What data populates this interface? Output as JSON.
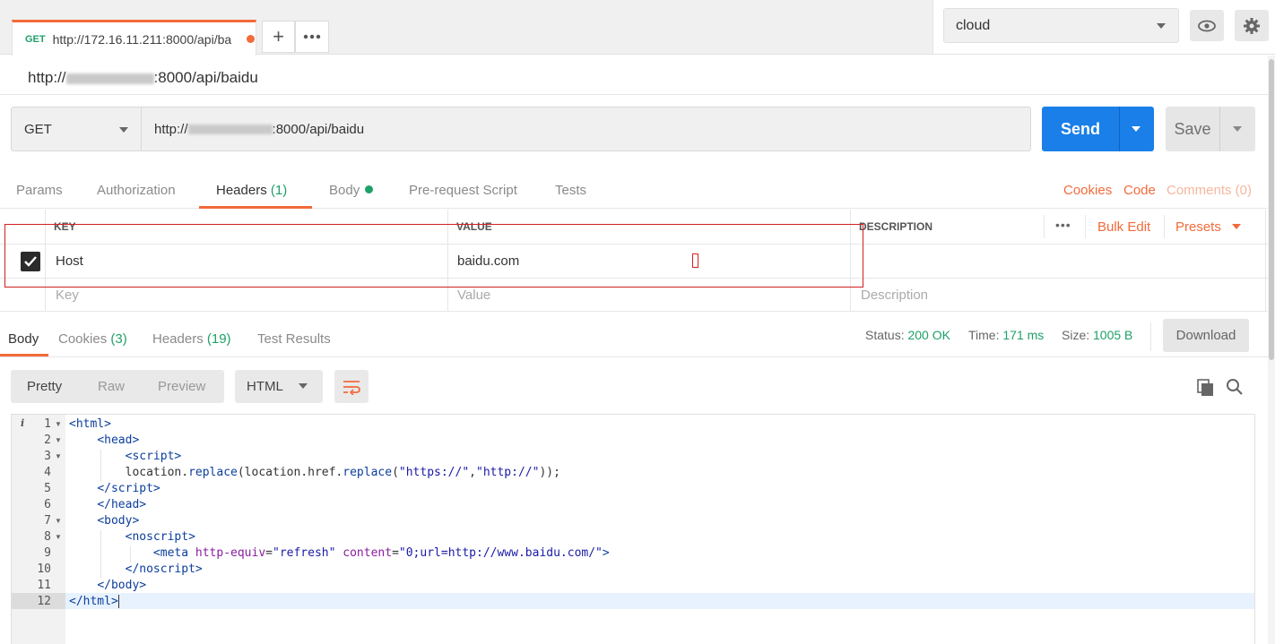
{
  "request_tab": {
    "method": "GET",
    "url": "http://172.16.11.211:8000/api/ba"
  },
  "environment": {
    "selected": "cloud"
  },
  "request_name": {
    "prefix": "http://",
    "suffix": ":8000/api/baidu"
  },
  "url_bar": {
    "method": "GET",
    "url_prefix": "http://",
    "url_suffix": ":8000/api/baidu"
  },
  "buttons": {
    "send": "Send",
    "save": "Save"
  },
  "request_tabs": {
    "params": "Params",
    "authorization": "Authorization",
    "headers": "Headers",
    "headers_count": "(1)",
    "body": "Body",
    "pre_request": "Pre-request Script",
    "tests": "Tests",
    "cookies": "Cookies",
    "code": "Code",
    "comments": "Comments (0)"
  },
  "headers_table": {
    "columns": {
      "key": "KEY",
      "value": "VALUE",
      "description": "DESCRIPTION"
    },
    "more": "•••",
    "bulk_edit": "Bulk Edit",
    "presets": "Presets",
    "rows": [
      {
        "key": "Host",
        "value": "baidu.com",
        "description": "",
        "enabled": true
      }
    ],
    "placeholders": {
      "key": "Key",
      "value": "Value",
      "description": "Description"
    }
  },
  "response_tabs": {
    "body": "Body",
    "cookies": "Cookies",
    "cookies_count": "(3)",
    "headers": "Headers",
    "headers_count": "(19)",
    "test_results": "Test Results"
  },
  "response_status": {
    "status_label": "Status:",
    "status": "200 OK",
    "time_label": "Time:",
    "time": "171 ms",
    "size_label": "Size:",
    "size": "1005 B"
  },
  "download": "Download",
  "format": {
    "pretty": "Pretty",
    "raw": "Raw",
    "preview": "Preview",
    "language": "HTML"
  },
  "code_lines": [
    "1",
    "2",
    "3",
    "4",
    "5",
    "6",
    "7",
    "8",
    "9",
    "10",
    "11",
    "12"
  ],
  "colors": {
    "accent": "#f26b3a",
    "send": "#1a7fe8",
    "success": "#1ea069"
  }
}
